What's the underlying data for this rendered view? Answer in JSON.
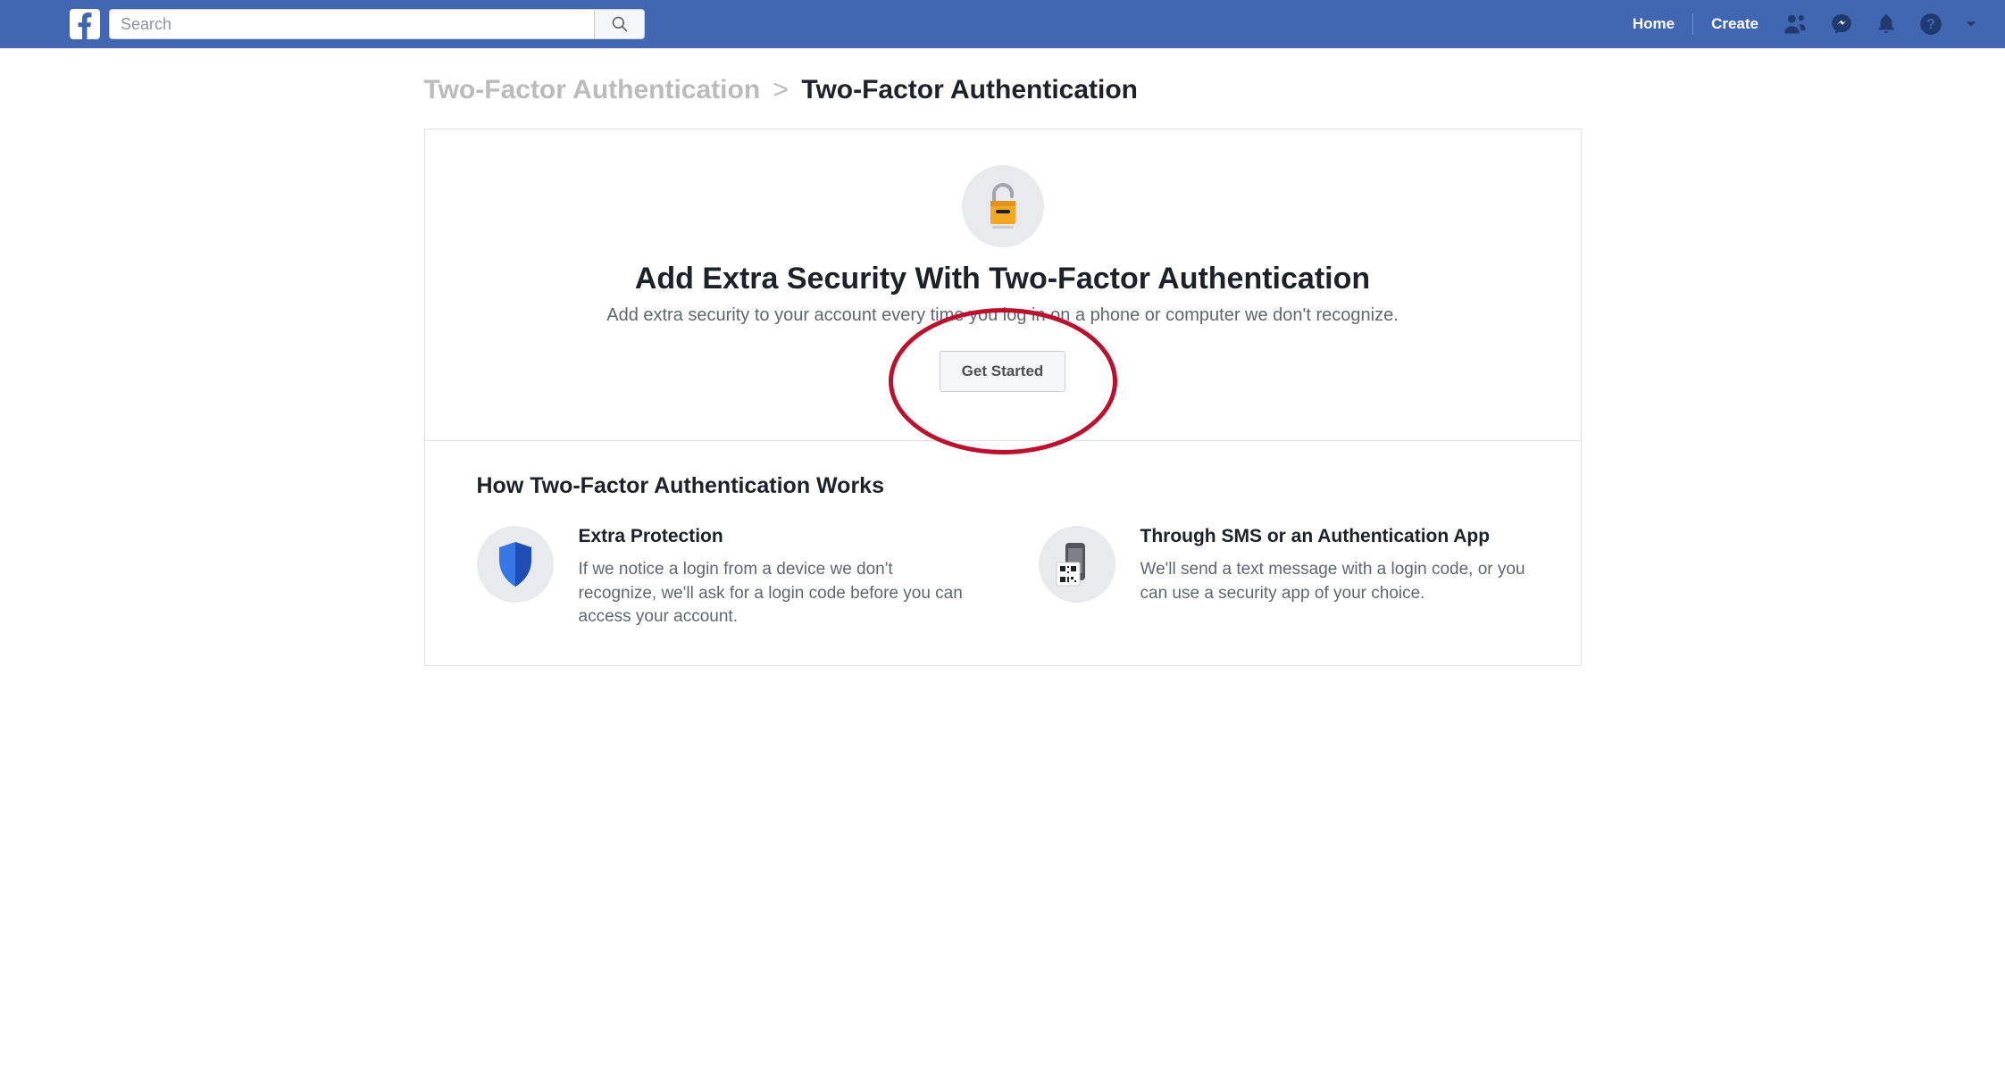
{
  "topbar": {
    "search_placeholder": "Search",
    "home_label": "Home",
    "create_label": "Create"
  },
  "breadcrumb": {
    "parent": "Two-Factor Authentication",
    "current": "Two-Factor Authentication"
  },
  "hero": {
    "title": "Add Extra Security With Two-Factor Authentication",
    "subtitle": "Add extra security to your account every time you log in on a phone or computer we don't recognize.",
    "button_label": "Get Started"
  },
  "how": {
    "heading": "How Two-Factor Authentication Works",
    "item1": {
      "title": "Extra Protection",
      "body": "If we notice a login from a device we don't recognize, we'll ask for a login code before you can access your account."
    },
    "item2": {
      "title": "Through SMS or an Authentication App",
      "body": "We'll send a text message with a login code, or you can use a security app of your choice."
    }
  }
}
